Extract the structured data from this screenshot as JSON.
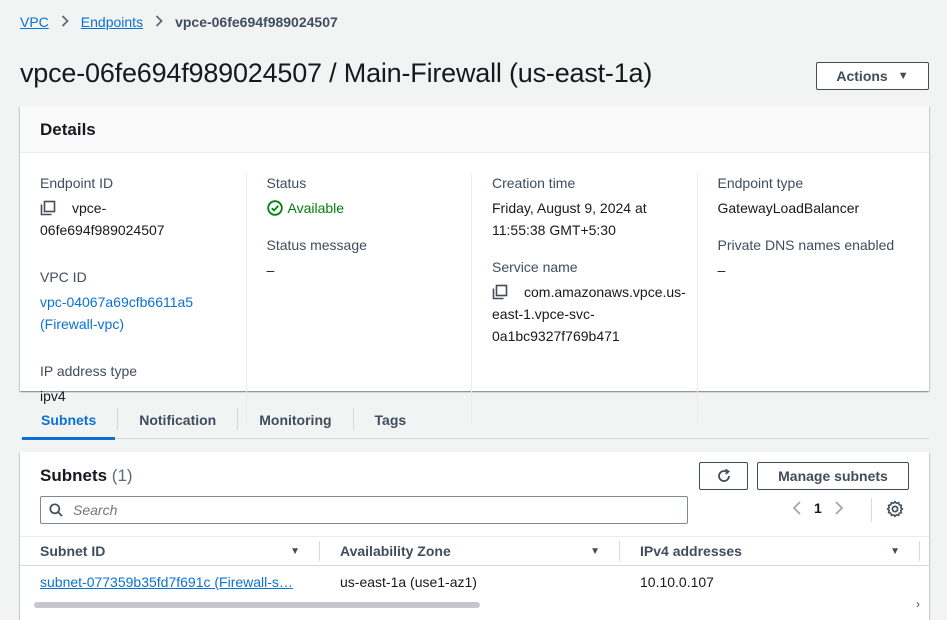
{
  "breadcrumb": {
    "items": [
      "VPC",
      "Endpoints"
    ],
    "current": "vpce-06fe694f989024507"
  },
  "page": {
    "title": "vpce-06fe694f989024507 / Main-Firewall (us-east-1a)",
    "actions_label": "Actions"
  },
  "details": {
    "header": "Details",
    "endpoint_id_label": "Endpoint ID",
    "endpoint_id_line1": "vpce-",
    "endpoint_id_line2": "06fe694f989024507",
    "vpc_id_label": "VPC ID",
    "vpc_id_line1": "vpc-04067a69cfb6611a5",
    "vpc_id_line2": "(Firewall-vpc)",
    "ip_type_label": "IP address type",
    "ip_type_value": "ipv4",
    "status_label": "Status",
    "status_value": "Available",
    "status_message_label": "Status message",
    "status_message_value": "–",
    "creation_label": "Creation time",
    "creation_line1": "Friday, August 9, 2024 at",
    "creation_line2": "11:55:38 GMT+5:30",
    "service_label": "Service name",
    "service_line1": "com.amazonaws.vpce.us-",
    "service_line2": "east-1.vpce-svc-",
    "service_line3": "0a1bc9327f769b471",
    "endpoint_type_label": "Endpoint type",
    "endpoint_type_value": "GatewayLoadBalancer",
    "private_dns_label": "Private DNS names enabled",
    "private_dns_value": "–"
  },
  "tabs": [
    "Subnets",
    "Notification",
    "Monitoring",
    "Tags"
  ],
  "subnets": {
    "title": "Subnets",
    "count": "(1)",
    "manage_label": "Manage subnets",
    "search_placeholder": "Search",
    "page_number": "1",
    "columns": [
      "Subnet ID",
      "Availability Zone",
      "IPv4 addresses"
    ],
    "rows": [
      {
        "subnet_id": "subnet-077359b35fd7f691c (Firewall-s…",
        "az": "us-east-1a (use1-az1)",
        "ipv4": "10.10.0.107"
      }
    ]
  },
  "colors": {
    "link": "#0972d3",
    "success": "#037f0c",
    "text": "#16191f",
    "background": "#f2f3f3"
  }
}
